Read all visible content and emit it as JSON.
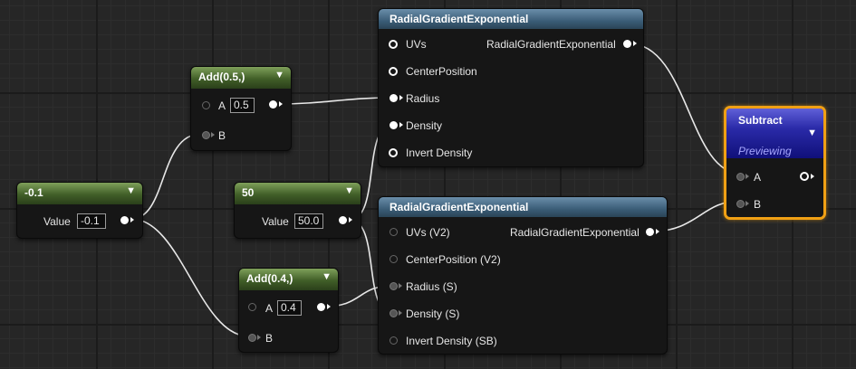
{
  "graph": {
    "nodes": {
      "const_neg": {
        "title": "-0.1",
        "value_label": "Value",
        "value": "-0.1"
      },
      "add_05": {
        "title": "Add(0.5,)",
        "a_label": "A",
        "a_value": "0.5",
        "b_label": "B"
      },
      "const_50": {
        "title": "50",
        "value_label": "Value",
        "value": "50.0"
      },
      "add_04": {
        "title": "Add(0.4,)",
        "a_label": "A",
        "a_value": "0.4",
        "b_label": "B"
      },
      "rge1": {
        "title": "RadialGradientExponential",
        "inputs": [
          "UVs",
          "CenterPosition",
          "Radius",
          "Density",
          "Invert Density"
        ],
        "output": "RadialGradientExponential"
      },
      "rge2": {
        "title": "RadialGradientExponential",
        "inputs": [
          "UVs (V2)",
          "CenterPosition (V2)",
          "Radius (S)",
          "Density (S)",
          "Invert Density (SB)"
        ],
        "output": "RadialGradientExponential"
      },
      "subtract": {
        "title": "Subtract",
        "status": "Previewing",
        "a_label": "A",
        "b_label": "B"
      }
    }
  },
  "colors": {
    "constant_header": "#5a7a3a",
    "function_header": "#3b5d77",
    "subtract_header": "#2a2aa8",
    "selection_outline": "#f0a014",
    "wire": "#e8e8e8"
  },
  "icons": {
    "chevron": "chevron-down-icon",
    "pin_connected": "pin-connected-icon",
    "pin_disconnected": "pin-disconnected-icon"
  }
}
